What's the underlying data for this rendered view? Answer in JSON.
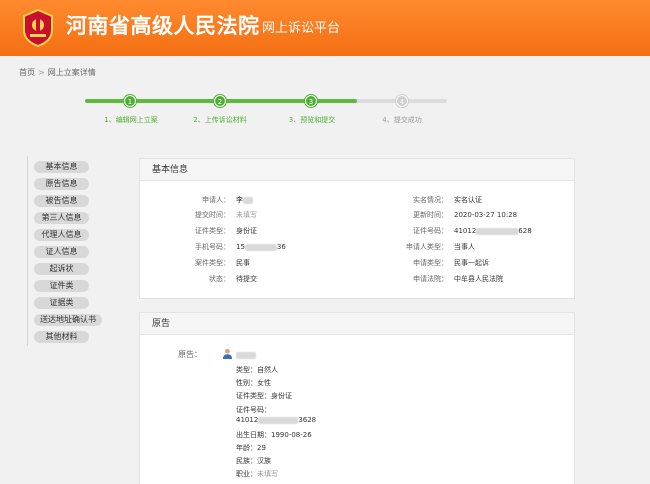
{
  "header": {
    "title": "河南省高级人民法院",
    "subtitle": "网上诉讼平台",
    "gradient_top": "#ff8a2f",
    "gradient_bottom": "#f46f12"
  },
  "breadcrumb": {
    "home": "首页",
    "separator": ">",
    "current": "网上立案详情"
  },
  "steps": [
    {
      "num": "1",
      "label": "1、编辑网上立案",
      "state": "done"
    },
    {
      "num": "2",
      "label": "2、上传诉讼材料",
      "state": "done"
    },
    {
      "num": "3",
      "label": "3、预览和提交",
      "state": "done"
    },
    {
      "num": "4",
      "label": "4、提交成功",
      "state": "todo"
    }
  ],
  "sidenav": [
    "基本信息",
    "原告信息",
    "被告信息",
    "第三人信息",
    "代理人信息",
    "证人信息",
    "起诉状",
    "证件类",
    "证据类",
    "送达地址确认书",
    "其他材料"
  ],
  "basic": {
    "title": "基本信息",
    "left": [
      {
        "label": "申请人：",
        "value": "李"
      },
      {
        "label": "提交时间：",
        "value": "未填写"
      },
      {
        "label": "证件类型：",
        "value": "身份证"
      },
      {
        "label": "手机号码：",
        "value_prefix": "15",
        "value_suffix": "36"
      },
      {
        "label": "案件类型：",
        "value": "民事"
      },
      {
        "label": "状态：",
        "value": "待提交"
      }
    ],
    "right": [
      {
        "label": "实名情况：",
        "value": "实名认证"
      },
      {
        "label": "更新时间：",
        "value": "2020-03-27 10:28"
      },
      {
        "label": "证件号码：",
        "value_prefix": "41012",
        "value_suffix": "628"
      },
      {
        "label": "申请人类型：",
        "value": "当事人"
      },
      {
        "label": "申请类型：",
        "value": "民事一起诉"
      },
      {
        "label": "申请法院：",
        "value": "中牟县人民法院"
      }
    ]
  },
  "plaintiff": {
    "title": "原告",
    "label": "原告：",
    "lines": [
      "类型：自然人",
      "性别：女性",
      "证件类型：身份证",
      "证件号码："
    ],
    "id_prefix": "41012",
    "id_suffix": "3628",
    "lines2": [
      "出生日期：1990-08-26",
      "年龄：29",
      "民族：汉族"
    ],
    "job_label": "职业：",
    "job_value": "未填写"
  }
}
